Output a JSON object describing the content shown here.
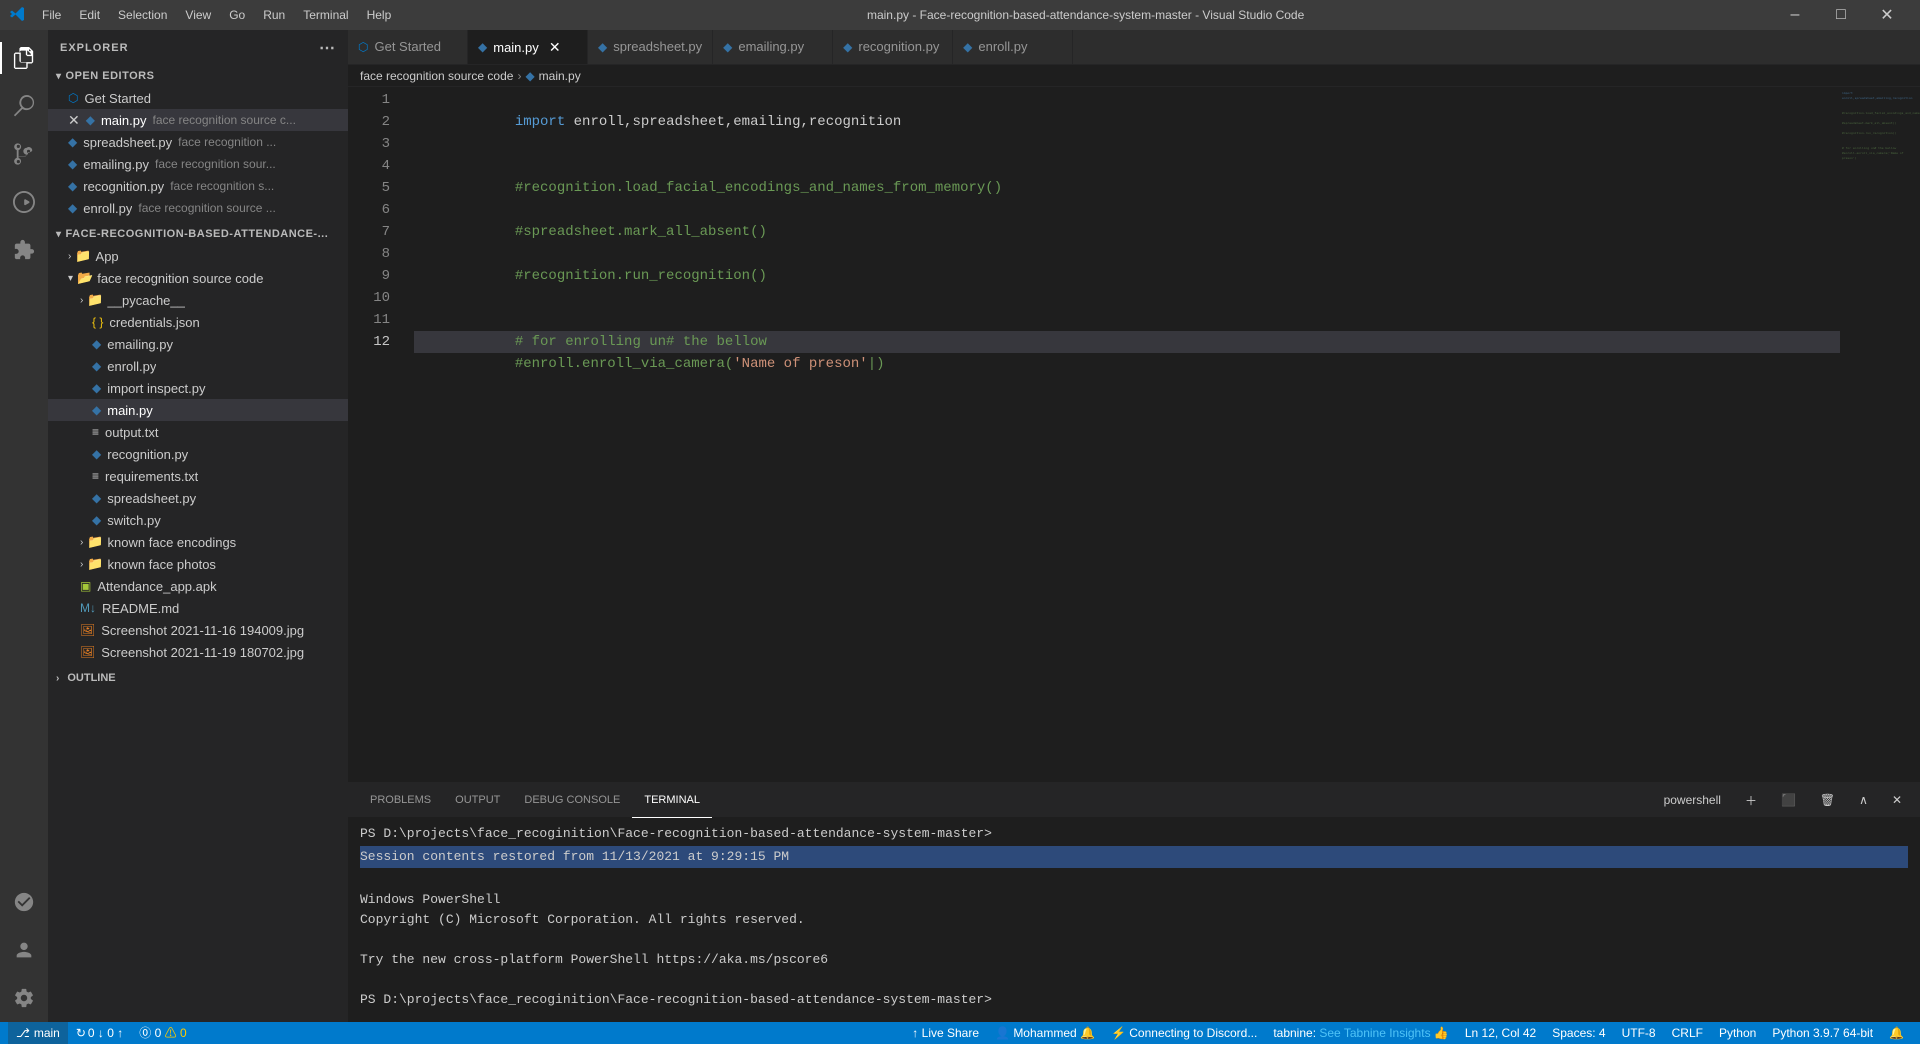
{
  "titlebar": {
    "title": "main.py - Face-recognition-based-attendance-system-master - Visual Studio Code",
    "menu": [
      "File",
      "Edit",
      "Selection",
      "View",
      "Go",
      "Run",
      "Terminal",
      "Help"
    ]
  },
  "tabs": [
    {
      "id": "get-started",
      "label": "Get Started",
      "icon": "vscode",
      "active": false,
      "modified": false
    },
    {
      "id": "main-py",
      "label": "main.py",
      "icon": "python",
      "active": true,
      "modified": true
    },
    {
      "id": "spreadsheet-py",
      "label": "spreadsheet.py",
      "icon": "python",
      "active": false,
      "modified": false
    },
    {
      "id": "emailing-py",
      "label": "emailing.py",
      "icon": "python",
      "active": false,
      "modified": false
    },
    {
      "id": "recognition-py",
      "label": "recognition.py",
      "icon": "python",
      "active": false,
      "modified": false
    },
    {
      "id": "enroll-py",
      "label": "enroll.py",
      "icon": "python",
      "active": false,
      "modified": false
    }
  ],
  "breadcrumb": {
    "parts": [
      "face recognition source code",
      ">",
      "main.py"
    ]
  },
  "code": {
    "lines": [
      {
        "num": 1,
        "content": "import enroll,spreadsheet,emailing,recognition",
        "type": "code"
      },
      {
        "num": 2,
        "content": "",
        "type": "empty"
      },
      {
        "num": 3,
        "content": "",
        "type": "empty"
      },
      {
        "num": 4,
        "content": "#recognition.load_facial_encodings_and_names_from_memory()",
        "type": "comment"
      },
      {
        "num": 5,
        "content": "",
        "type": "empty"
      },
      {
        "num": 6,
        "content": "#spreadsheet.mark_all_absent()",
        "type": "comment"
      },
      {
        "num": 7,
        "content": "",
        "type": "empty"
      },
      {
        "num": 8,
        "content": "#recognition.run_recognition()",
        "type": "comment"
      },
      {
        "num": 9,
        "content": "",
        "type": "empty"
      },
      {
        "num": 10,
        "content": "",
        "type": "empty"
      },
      {
        "num": 11,
        "content": "# for enrolling un# the bellow",
        "type": "comment"
      },
      {
        "num": 12,
        "content": "#enroll.enroll_via_camera('Name of preson')",
        "type": "comment_active"
      }
    ]
  },
  "sidebar": {
    "title": "Explorer",
    "open_editors": {
      "label": "Open Editors",
      "items": [
        {
          "name": "Get Started",
          "icon": "vscode",
          "path": ""
        },
        {
          "name": "main.py",
          "icon": "python",
          "path": "face recognition source c...",
          "active": true,
          "modified": true
        },
        {
          "name": "spreadsheet.py",
          "icon": "python",
          "path": "face recognition ..."
        },
        {
          "name": "emailing.py",
          "icon": "python",
          "path": "face recognition sour..."
        },
        {
          "name": "recognition.py",
          "icon": "python",
          "path": "face recognition s..."
        },
        {
          "name": "enroll.py",
          "icon": "python",
          "path": "face recognition source ..."
        }
      ]
    },
    "project": {
      "label": "FACE-RECOGNITION-BASED-ATTENDANCE-...",
      "items": [
        {
          "type": "folder",
          "name": "App",
          "indent": 1,
          "collapsed": true
        },
        {
          "type": "folder",
          "name": "face recognition source code",
          "indent": 1,
          "collapsed": false
        },
        {
          "type": "folder",
          "name": "__pycache__",
          "indent": 2,
          "collapsed": true
        },
        {
          "type": "file",
          "name": "credentials.json",
          "icon": "json",
          "indent": 3
        },
        {
          "type": "file",
          "name": "emailing.py",
          "icon": "python",
          "indent": 3
        },
        {
          "type": "file",
          "name": "enroll.py",
          "icon": "python",
          "indent": 3
        },
        {
          "type": "file",
          "name": "import inspect.py",
          "icon": "python",
          "indent": 3
        },
        {
          "type": "file",
          "name": "main.py",
          "icon": "python",
          "indent": 3,
          "active": true
        },
        {
          "type": "file",
          "name": "output.txt",
          "icon": "txt",
          "indent": 3
        },
        {
          "type": "file",
          "name": "recognition.py",
          "icon": "python",
          "indent": 3
        },
        {
          "type": "file",
          "name": "requirements.txt",
          "icon": "txt",
          "indent": 3
        },
        {
          "type": "file",
          "name": "spreadsheet.py",
          "icon": "python",
          "indent": 3
        },
        {
          "type": "file",
          "name": "switch.py",
          "icon": "python",
          "indent": 3
        },
        {
          "type": "folder",
          "name": "known face encodings",
          "indent": 2,
          "collapsed": true
        },
        {
          "type": "folder",
          "name": "known face photos",
          "indent": 2,
          "collapsed": true
        },
        {
          "type": "file",
          "name": "Attendance_app.apk",
          "icon": "apk",
          "indent": 2
        },
        {
          "type": "file",
          "name": "README.md",
          "icon": "md",
          "indent": 2
        },
        {
          "type": "file",
          "name": "Screenshot 2021-11-16 194009.jpg",
          "icon": "jpg",
          "indent": 2
        },
        {
          "type": "file",
          "name": "Screenshot 2021-11-19 180702.jpg",
          "icon": "jpg",
          "indent": 2
        }
      ]
    },
    "outline": {
      "label": "Outline"
    }
  },
  "panel": {
    "tabs": [
      "PROBLEMS",
      "OUTPUT",
      "DEBUG CONSOLE",
      "TERMINAL"
    ],
    "active_tab": "TERMINAL",
    "terminal": {
      "shell": "powershell",
      "lines": [
        "PS D:\\projects\\face_recoginition\\Face-recognition-based-attendance-system-master>",
        "",
        "Session contents restored from 11/13/2021 at 9:29:15 PM",
        "",
        "Windows PowerShell",
        "Copyright (C) Microsoft Corporation. All rights reserved.",
        "",
        "Try the new cross-platform PowerShell https://aka.ms/pscore6",
        "",
        "PS D:\\projects\\face_recoginition\\Face-recognition-based-attendance-system-master>"
      ]
    }
  },
  "status_bar": {
    "left": [
      {
        "id": "branch",
        "text": "main",
        "icon": "git"
      },
      {
        "id": "sync",
        "text": "0 ↓ 0 ↑"
      },
      {
        "id": "errors",
        "text": "⓪ 0  ⚠ 0"
      }
    ],
    "right": [
      {
        "id": "ln-col",
        "text": "Ln 12, Col 42"
      },
      {
        "id": "spaces",
        "text": "Spaces: 4"
      },
      {
        "id": "encoding",
        "text": "UTF-8"
      },
      {
        "id": "line-ending",
        "text": "CRLF"
      },
      {
        "id": "language",
        "text": "Python"
      },
      {
        "id": "live-share",
        "text": "Live Share"
      },
      {
        "id": "discord",
        "text": "⚡ Connecting to Discord..."
      },
      {
        "id": "tabnine",
        "text": "tabnine:"
      },
      {
        "id": "tabnine-link",
        "text": "See Tabnine Insights 👍"
      },
      {
        "id": "user",
        "text": "Mohammed 🔔"
      },
      {
        "id": "python-version",
        "text": "Python 3.9.7 64-bit"
      },
      {
        "id": "notif",
        "text": "🔔"
      }
    ]
  },
  "icons": {
    "python_color": "#3572A5",
    "json_color": "#f1c40f",
    "txt_color": "#cccccc",
    "md_color": "#519aba",
    "jpg_color": "#e67e22",
    "folder_color": "#e8ab53",
    "vscode_color": "#007acc"
  }
}
